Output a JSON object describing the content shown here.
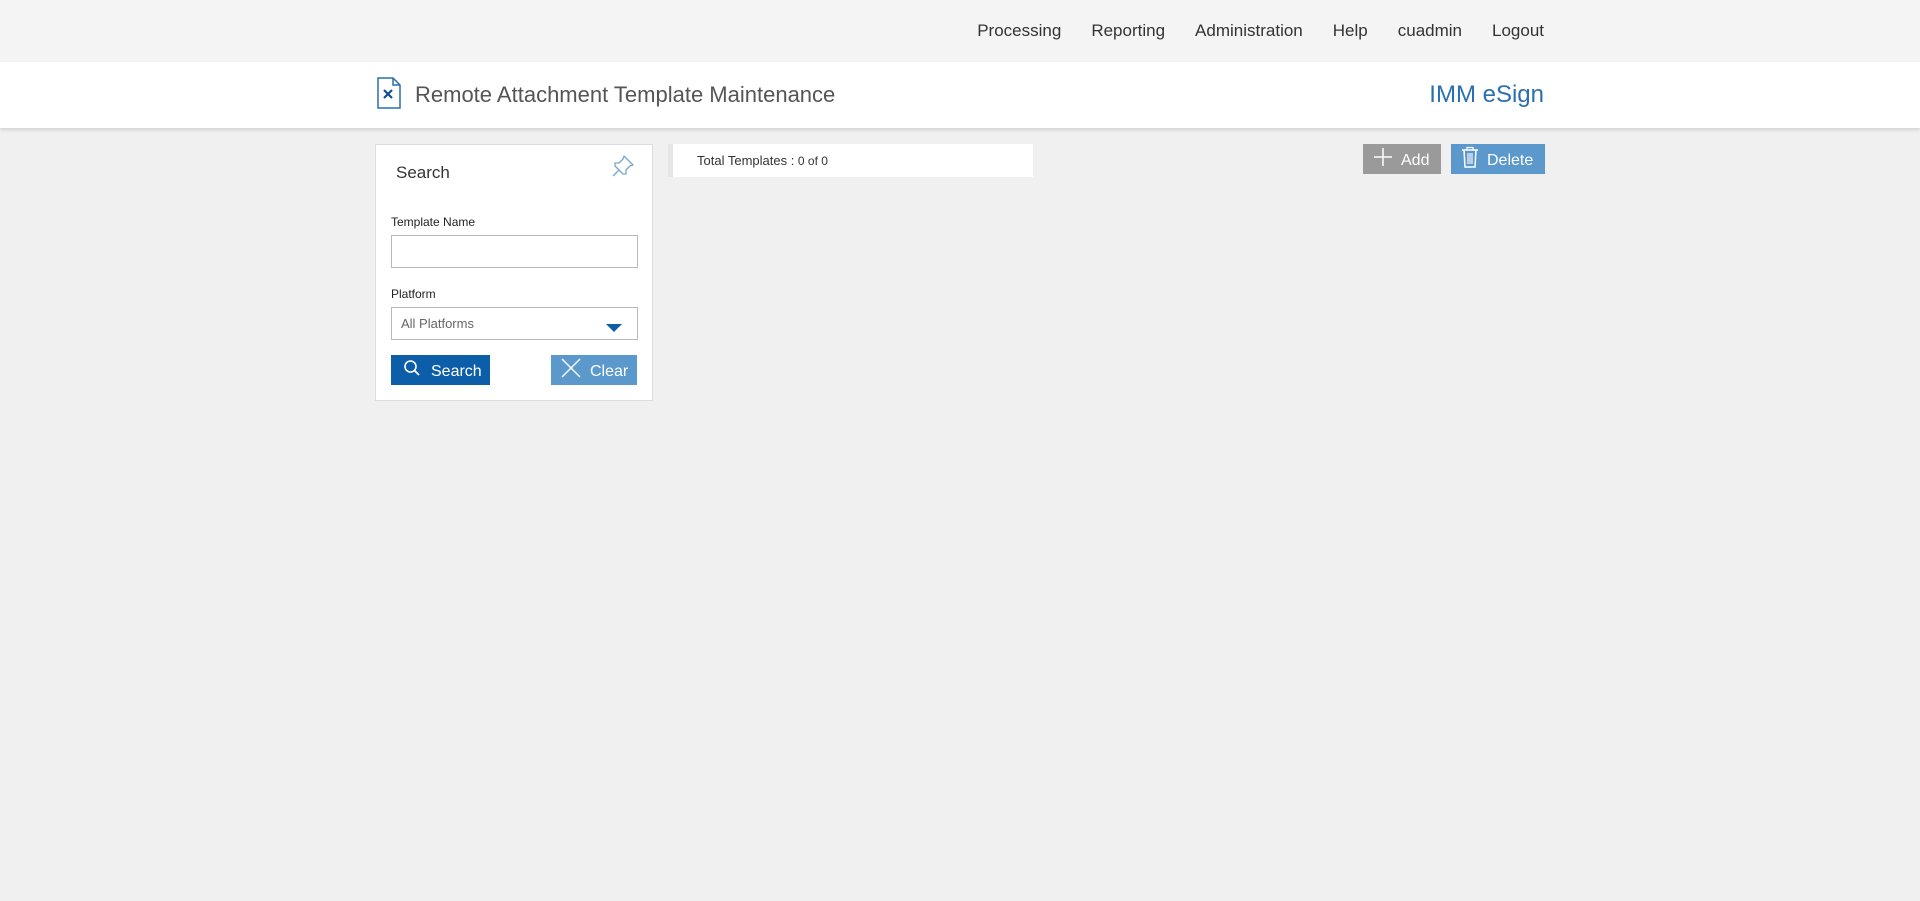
{
  "nav": {
    "items": [
      {
        "label": "Processing"
      },
      {
        "label": "Reporting"
      },
      {
        "label": "Administration"
      },
      {
        "label": "Help"
      },
      {
        "label": "cuadmin"
      },
      {
        "label": "Logout"
      }
    ]
  },
  "header": {
    "title": "Remote Attachment Template Maintenance",
    "brand": "IMM eSign",
    "icon": "document-x-icon"
  },
  "search": {
    "panel_title": "Search",
    "template_name_label": "Template Name",
    "template_name_value": "",
    "platform_label": "Platform",
    "platform_value": "All Platforms",
    "search_label": "Search",
    "clear_label": "Clear"
  },
  "results": {
    "total_label": "Total Templates : ",
    "total_value": "0 of 0"
  },
  "actions": {
    "add_label": "Add",
    "delete_label": "Delete"
  },
  "colors": {
    "brand": "#2a6fb0",
    "primary_button": "#0d5ea8",
    "secondary_button": "#5b98cc",
    "disabled_button": "#9a9a9a"
  }
}
